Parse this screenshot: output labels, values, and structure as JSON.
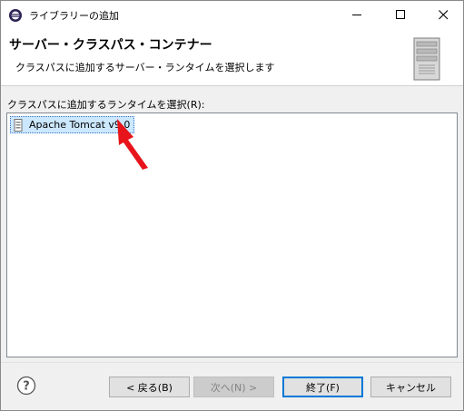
{
  "window": {
    "title": "ライブラリーの追加"
  },
  "banner": {
    "title": "サーバー・クラスパス・コンテナー",
    "description": "クラスパスに追加するサーバー・ランタイムを選択します"
  },
  "runtime_list": {
    "label": "クラスパスに追加するランタイムを選択(R):",
    "items": [
      {
        "label": "Apache Tomcat v9.0",
        "selected": true
      }
    ]
  },
  "buttons": {
    "back": "< 戻る(B)",
    "next": "次へ(N) >",
    "finish": "終了(F)",
    "cancel": "キャンセル"
  },
  "colors": {
    "selection": "#cce8ff",
    "focus_border": "#0078d7",
    "annotation_arrow": "#e8141c"
  }
}
